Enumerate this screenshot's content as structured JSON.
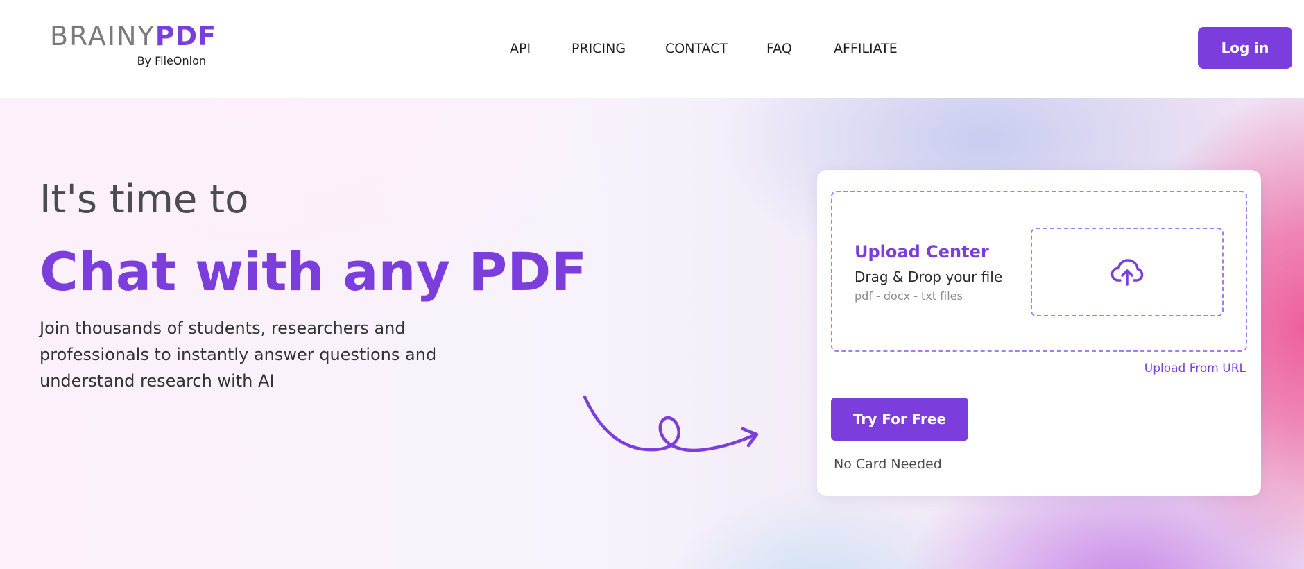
{
  "header": {
    "logo": {
      "brainy": "BRAINY",
      "pdf": "PDF",
      "byline": "By FileOnion"
    },
    "nav": [
      "API",
      "PRICING",
      "CONTACT",
      "FAQ",
      "AFFILIATE"
    ],
    "login_label": "Log in"
  },
  "hero": {
    "eyebrow": "It's time to",
    "title": "Chat with any PDF",
    "description": "Join thousands of students, researchers and professionals to instantly answer questions and understand research with AI"
  },
  "upload_card": {
    "title": "Upload Center",
    "subtitle": "Drag & Drop your file",
    "file_types": "pdf - docx - txt files",
    "upload_icon": "cloud-upload-icon",
    "url_link": "Upload From URL",
    "cta_label": "Try For Free",
    "cta_note": "No Card Needed"
  },
  "colors": {
    "accent": "#7c3ddd",
    "text_dark": "#1e1e1e",
    "text_muted": "#8a8a8a"
  }
}
